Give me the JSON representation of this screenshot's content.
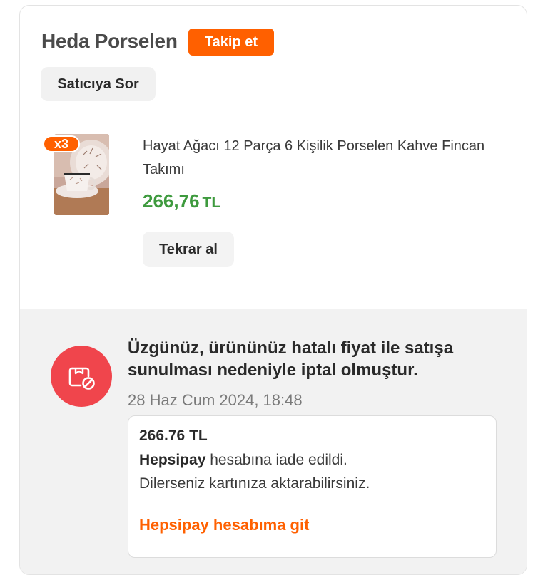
{
  "seller": {
    "name": "Heda Porselen",
    "follow_label": "Takip et",
    "ask_label": "Satıcıya Sor"
  },
  "product": {
    "quantity_badge": "x3",
    "title": "Hayat Ağacı 12 Parça 6 Kişilik Porselen Kahve Fincan Takımı",
    "price_amount": "266,76",
    "price_currency": "TL",
    "rebuy_label": "Tekrar al",
    "image_icon": "coffee-cup-set-photo"
  },
  "status": {
    "icon": "cancelled-package-icon",
    "title": "Üzgünüz, ürününüz hatalı fiyat ile satışa sunulması nedeniyle iptal olmuştur.",
    "date": "28 Haz Cum 2024, 18:48"
  },
  "refund": {
    "amount": "266.76 TL",
    "brand": "Hepsipay",
    "line1_rest": " hesabına iade edildi.",
    "line2": "Dilerseniz kartınıza aktarabilirsiniz.",
    "link_label": "Hepsipay hesabıma git"
  },
  "colors": {
    "accent": "#ff6000",
    "price": "#3e9a3e",
    "alert": "#f0454c"
  }
}
